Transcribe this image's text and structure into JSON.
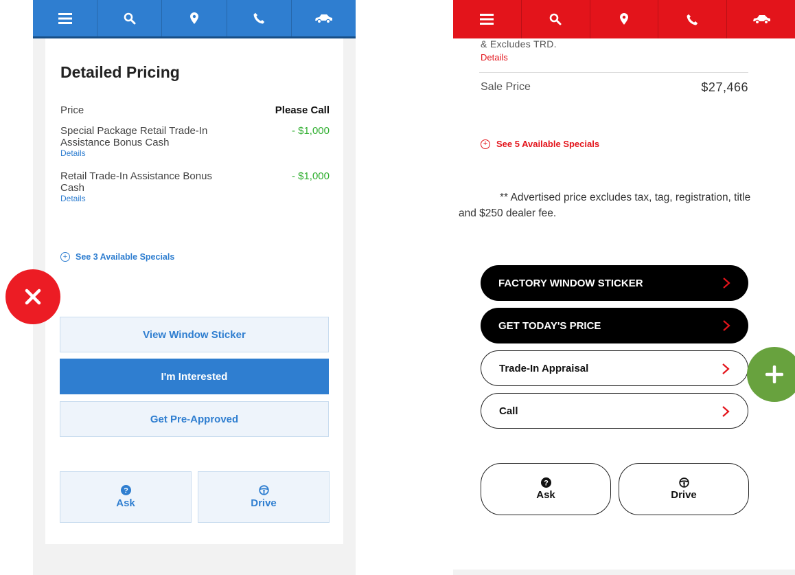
{
  "left": {
    "nav_icons": [
      "menu-icon",
      "search-icon",
      "location-pin-icon",
      "phone-icon",
      "car-icon"
    ],
    "title": "Detailed Pricing",
    "price_rows": [
      {
        "label": "Price",
        "value": "Please Call",
        "details": ""
      },
      {
        "label": "Special Package Retail Trade-In Assistance Bonus Cash",
        "value": "- $1,000",
        "details": "Details"
      },
      {
        "label": "Retail Trade-In Assistance Bonus Cash",
        "value": "- $1,000",
        "details": "Details"
      }
    ],
    "specials_link": "See 3 Available Specials",
    "buttons": {
      "window_sticker": "View Window Sticker",
      "interested": "I'm Interested",
      "pre_approved": "Get Pre-Approved"
    },
    "tiles": {
      "ask": "Ask",
      "drive": "Drive"
    },
    "accent_color": "#2f7ed0",
    "badge": "close-icon",
    "badge_color": "#ec1c24"
  },
  "right": {
    "nav_icons": [
      "menu-icon",
      "search-icon",
      "location-pin-icon",
      "phone-icon",
      "car-icon"
    ],
    "excludes_text": "& Excludes TRD.",
    "details_link": "Details",
    "sale_price_label": "Sale Price",
    "sale_price_value": "$27,466",
    "specials_link": "See 5 Available Specials",
    "disclaimer": "** Advertised price excludes tax, tag, registration, title and $250 dealer fee.",
    "buttons": {
      "factory_sticker": "FACTORY WINDOW STICKER",
      "todays_price": "GET TODAY'S PRICE",
      "trade_in": "Trade-In Appraisal",
      "call": "Call"
    },
    "tiles": {
      "ask": "Ask",
      "drive": "Drive"
    },
    "accent_color": "#e3141b",
    "badge": "plus-icon",
    "badge_color": "#68a23e"
  }
}
